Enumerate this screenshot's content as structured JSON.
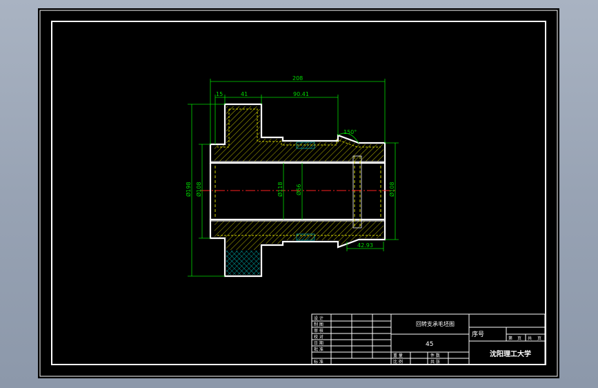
{
  "drawing": {
    "dimensions": {
      "overall_length": "208",
      "len_15": "15",
      "len_41": "41",
      "len_90": "90.41",
      "angle": "150°",
      "len_42": "42.93",
      "dia_left_outer": "Ø198",
      "dia_left_inner": "Ø108",
      "dia_bore": "Ø118",
      "dia_mid": "Ø56",
      "dia_right": "Ø108"
    }
  },
  "title_block": {
    "part_name": "回转支承毛坯图",
    "material": "45",
    "label_seq": "序号",
    "sheet_info": [
      "第",
      "页",
      "共",
      "页"
    ],
    "org": "沈阳理工大学",
    "row_labels": [
      "设 计",
      "制 图",
      "审 核",
      "校 对",
      "日 期",
      "批 准",
      "标 准"
    ],
    "sign_labels": [
      "重 量",
      "比 例"
    ],
    "quantity_labels": [
      "件 数",
      "共 张"
    ]
  },
  "colors": {
    "background_outer": "#9aa5b5",
    "sheet": "#000000",
    "line_white": "#ffffff",
    "dimension": "#00ff00",
    "hatch_yellow": "#c8c800",
    "hatch_cyan": "#00c8c8",
    "centerline": "#ff2020"
  }
}
